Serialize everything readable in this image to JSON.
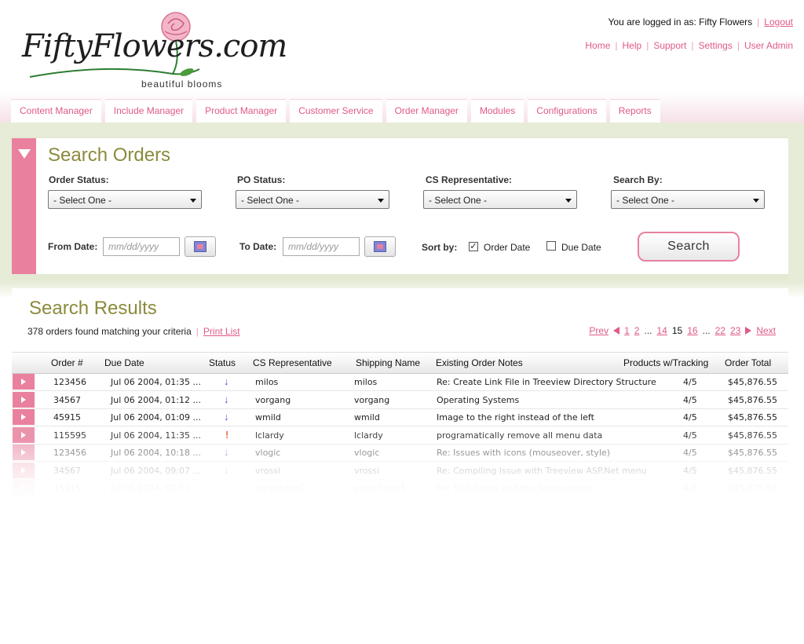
{
  "brand": {
    "logo_text": "FiftyFlowers.com",
    "tagline": "beautiful blooms"
  },
  "header": {
    "logged_in_text": "You are logged in as: Fifty Flowers",
    "logout": "Logout",
    "links": [
      "Home",
      "Help",
      "Support",
      "Settings",
      "User Admin"
    ]
  },
  "nav": {
    "tabs": [
      "Content Manager",
      "Include Manager",
      "Product Manager",
      "Customer Service",
      "Order Manager",
      "Modules",
      "Configurations",
      "Reports"
    ]
  },
  "search": {
    "title": "Search Orders",
    "order_status_label": "Order Status:",
    "po_status_label": "PO Status:",
    "cs_rep_label": "CS Representative:",
    "search_by_label": "Search By:",
    "select_default": "- Select One -",
    "from_date_label": "From Date:",
    "to_date_label": "To Date:",
    "date_placeholder": "mm/dd/yyyy",
    "sort_by_label": "Sort by:",
    "sort_order_date": "Order Date",
    "sort_due_date": "Due Date",
    "sort_order_date_checked": true,
    "sort_due_date_checked": false,
    "search_button": "Search"
  },
  "results": {
    "title": "Search Results",
    "found_text": "378 orders found matching your criteria",
    "print_list": "Print List",
    "pager": {
      "prev": "Prev",
      "next": "Next",
      "pages": [
        "1",
        "2",
        "...",
        "14",
        "15",
        "16",
        "...",
        "22",
        "23"
      ],
      "current": "15"
    },
    "columns": [
      "Order #",
      "Due Date",
      "Status",
      "CS Representative",
      "Shipping Name",
      "Existing Order Notes",
      "Products w/Tracking",
      "Order Total"
    ],
    "rows": [
      {
        "order": "123456",
        "due": "Jul 06 2004, 01:35 ...",
        "status": "down-arrow-icon",
        "rep": "milos",
        "ship": "milos",
        "notes": "Re: Create Link File in Treeview Directory Structure",
        "tracking": "4/5",
        "total": "$45,876.55"
      },
      {
        "order": "34567",
        "due": "Jul 06 2004, 01:12 ...",
        "status": "down-arrow-icon",
        "rep": "vorgang",
        "ship": "vorgang",
        "notes": "Operating Systems",
        "tracking": "4/5",
        "total": "$45,876.55"
      },
      {
        "order": "45915",
        "due": "Jul 06 2004, 01:09 ...",
        "status": "down-arrow-icon",
        "rep": "wmild",
        "ship": "wmild",
        "notes": "Image to the right instead of the left",
        "tracking": "4/5",
        "total": "$45,876.55"
      },
      {
        "order": "115595",
        "due": "Jul 06 2004, 11:35 ...",
        "status": "exclamation-icon",
        "rep": "lclardy",
        "ship": "lclardy",
        "notes": "programatically remove all menu data",
        "tracking": "4/5",
        "total": "$45,876.55"
      },
      {
        "order": "123456",
        "due": "Jul 06 2004, 10:18 ...",
        "status": "down-arrow-icon",
        "rep": "vlogic",
        "ship": "vlogic",
        "notes": "Re: Issues with icons (mouseover, style)",
        "tracking": "4/5",
        "total": "$45,876.55"
      },
      {
        "order": "34567",
        "due": "Jul 06 2004, 09:07 ...",
        "status": "down-arrow-icon",
        "rep": "vrossi",
        "ship": "vrossi",
        "notes": "Re: Compiling Issue with Treeview ASP.Net menu",
        "tracking": "4/5",
        "total": "$45,876.55"
      },
      {
        "order": "45915",
        "due": "Jul 06 2004, 03:51 ...",
        "status": "down-arrow-icon",
        "rep": "garycheng1",
        "ship": "garycheng1",
        "notes": "Re: Text boxes and the Snap control",
        "tracking": "4/5",
        "total": "$45,876.55"
      }
    ]
  },
  "colors": {
    "accent_pink": "#e9819e",
    "link_pink": "#e05a86",
    "title_olive": "#8b8a3c",
    "panel_green": "#e7ecd8"
  }
}
